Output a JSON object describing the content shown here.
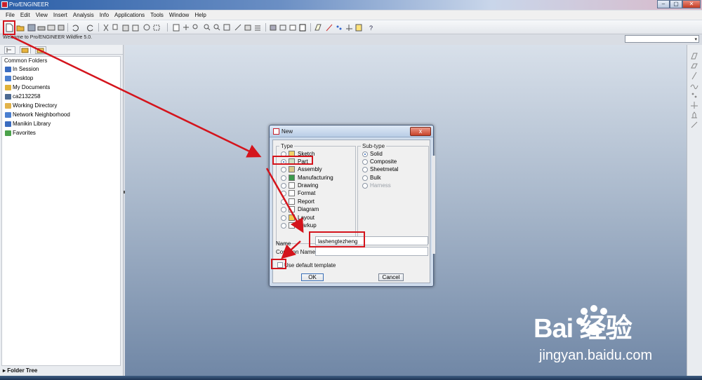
{
  "window": {
    "title": "Pro/ENGINEER",
    "controls": [
      "minimize",
      "maximize",
      "close"
    ]
  },
  "menu": [
    "File",
    "Edit",
    "View",
    "Insert",
    "Analysis",
    "Info",
    "Applications",
    "Tools",
    "Window",
    "Help"
  ],
  "message_line": "Welcome to Pro/ENGINEER Wildfire 5.0.",
  "navigator": {
    "tabs": [
      "model-tree-icon",
      "folder-browser-icon",
      "favorites-icon"
    ],
    "section_title": "Common Folders",
    "items": [
      {
        "label": "In Session",
        "icon": "session-icon",
        "color": "#3a6cc0"
      },
      {
        "label": "Desktop",
        "icon": "desktop-icon",
        "color": "#4a7fd0"
      },
      {
        "label": "My Documents",
        "icon": "documents-icon",
        "color": "#e0b23a"
      },
      {
        "label": "ca2132258",
        "icon": "computer-icon",
        "color": "#4d6a91"
      },
      {
        "label": "Working Directory",
        "icon": "folder-icon",
        "color": "#e2b34a"
      },
      {
        "label": "Network Neighborhood",
        "icon": "network-icon",
        "color": "#4a7fd0"
      },
      {
        "label": "Manikin Library",
        "icon": "manikin-icon",
        "color": "#3a6cc0"
      },
      {
        "label": "Favorites",
        "icon": "favorites-icon",
        "color": "#4ba24b"
      }
    ],
    "footer": "Folder Tree"
  },
  "dialog": {
    "title": "New",
    "close_label": "x",
    "type_label": "Type",
    "types": [
      {
        "label": "Sketch",
        "selected": false
      },
      {
        "label": "Part",
        "selected": true
      },
      {
        "label": "Assembly",
        "selected": false
      },
      {
        "label": "Manufacturing",
        "selected": false
      },
      {
        "label": "Drawing",
        "selected": false
      },
      {
        "label": "Format",
        "selected": false
      },
      {
        "label": "Report",
        "selected": false
      },
      {
        "label": "Diagram",
        "selected": false
      },
      {
        "label": "Layout",
        "selected": false
      },
      {
        "label": "Markup",
        "selected": false
      }
    ],
    "subtype_label": "Sub-type",
    "subtypes": [
      {
        "label": "Solid",
        "selected": true,
        "disabled": false
      },
      {
        "label": "Composite",
        "selected": false,
        "disabled": false
      },
      {
        "label": "Sheetmetal",
        "selected": false,
        "disabled": false
      },
      {
        "label": "Bulk",
        "selected": false,
        "disabled": false
      },
      {
        "label": "Harness",
        "selected": false,
        "disabled": true
      }
    ],
    "name_label": "Name",
    "name_value": "lashengtezheng",
    "common_name_label": "Common Name",
    "common_name_value": "",
    "use_default_template_label": "Use default template",
    "use_default_template_checked": false,
    "ok_label": "OK",
    "cancel_label": "Cancel"
  },
  "watermark": {
    "logo": "Bai  经验",
    "url": "jingyan.baidu.com"
  }
}
